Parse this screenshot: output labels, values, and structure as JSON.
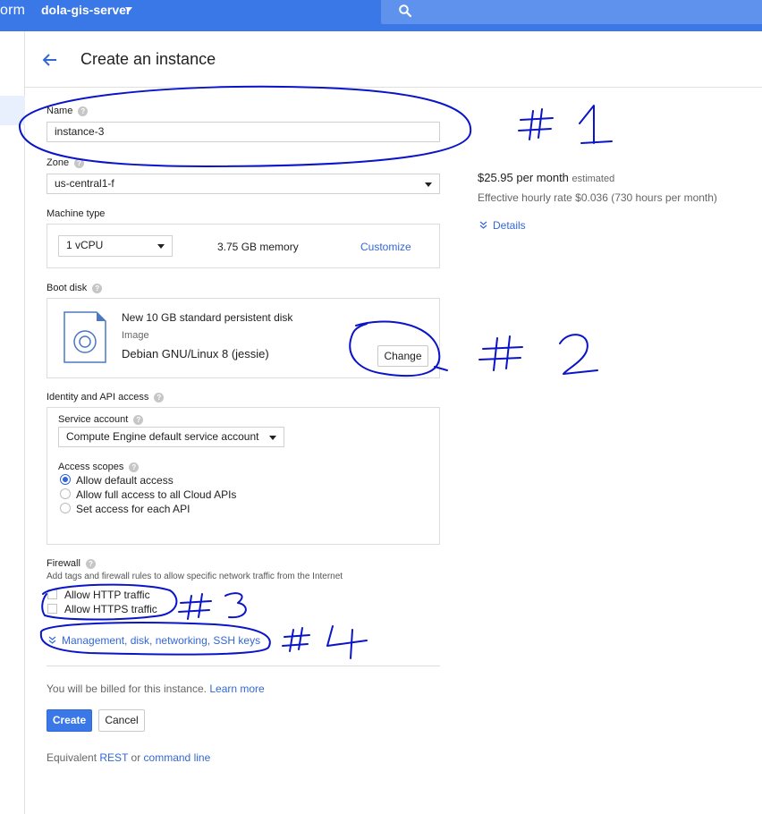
{
  "topbar": {
    "brand": "orm",
    "project": "dola-gis-server"
  },
  "header": {
    "title": "Create an instance"
  },
  "form": {
    "name": {
      "label": "Name",
      "value": "instance-3"
    },
    "zone": {
      "label": "Zone",
      "value": "us-central1-f"
    },
    "machine_type": {
      "label": "Machine type",
      "cpu": "1 vCPU",
      "memory": "3.75 GB memory",
      "customize": "Customize"
    },
    "boot_disk": {
      "label": "Boot disk",
      "description": "New 10 GB standard persistent disk",
      "image_label": "Image",
      "image_value": "Debian GNU/Linux 8 (jessie)",
      "change": "Change"
    },
    "identity": {
      "label": "Identity and API access",
      "service_account_label": "Service account",
      "service_account_value": "Compute Engine default service account",
      "access_scopes_label": "Access scopes",
      "scopes": [
        {
          "label": "Allow default access",
          "selected": true
        },
        {
          "label": "Allow full access to all Cloud APIs",
          "selected": false
        },
        {
          "label": "Set access for each API",
          "selected": false
        }
      ]
    },
    "firewall": {
      "label": "Firewall",
      "description": "Add tags and firewall rules to allow specific network traffic from the Internet",
      "http": "Allow HTTP traffic",
      "https": "Allow HTTPS traffic"
    },
    "management_link": "Management, disk, networking, SSH keys",
    "billing_note": "You will be billed for this instance.",
    "learn_more": "Learn more",
    "create": "Create",
    "cancel": "Cancel",
    "equivalent_label": "Equivalent",
    "rest": "REST",
    "or": "or",
    "command_line": "command line"
  },
  "pricing": {
    "price": "$25.95 per month",
    "estimated": "estimated",
    "hourly": "Effective hourly rate $0.036 (730 hours per month)",
    "details": "Details"
  },
  "annotations": {
    "a1": "#1",
    "a2": "#2",
    "a3": "#3",
    "a4": "#4"
  },
  "colors": {
    "appbar": "#3b78e7",
    "link": "#3367d6",
    "annotation_ink": "#0a14c8"
  }
}
